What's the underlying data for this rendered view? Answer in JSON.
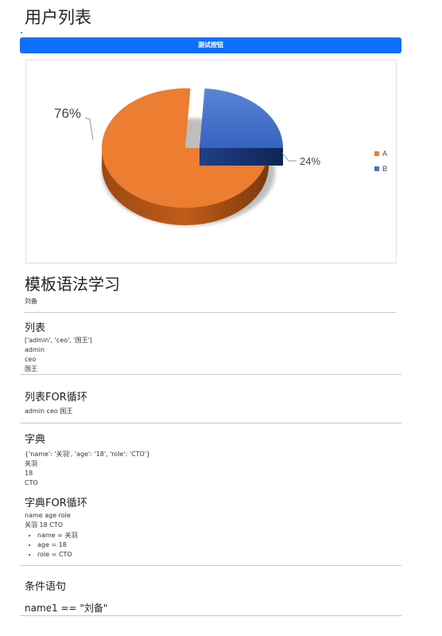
{
  "page": {
    "title": "用户列表"
  },
  "test_button": {
    "label": "测试按钮"
  },
  "chart_data": {
    "type": "pie",
    "categories": [
      "A",
      "B"
    ],
    "values": [
      76,
      24
    ],
    "labels": [
      "76%",
      "24%"
    ],
    "colors": [
      "#ed7d31",
      "#4472c4"
    ],
    "legend": "right",
    "style": "3d-exploded"
  },
  "template": {
    "heading": "模板语法学习",
    "name_value": "刘备",
    "list_section": {
      "title": "列表",
      "raw": "['admin', 'ceo', '国王']",
      "items": [
        "admin",
        "ceo",
        "国王"
      ]
    },
    "list_for_section": {
      "title": "列表FOR循环",
      "joined": "admin ceo 国王"
    },
    "dict_section": {
      "title": "字典",
      "raw": "{'name': '关羽', 'age': '18', 'role': 'CTO'}",
      "values": [
        "关羽",
        "18",
        "CTO"
      ]
    },
    "dict_for_section": {
      "title": "字典FOR循环",
      "keys": "name age role",
      "vals": "关羽 18 CTO",
      "pairs": [
        "name = 关羽",
        "age = 18",
        "role = CTO"
      ]
    },
    "condition_section": {
      "title": "条件语句",
      "expr": "name1 == \"刘备\""
    }
  }
}
